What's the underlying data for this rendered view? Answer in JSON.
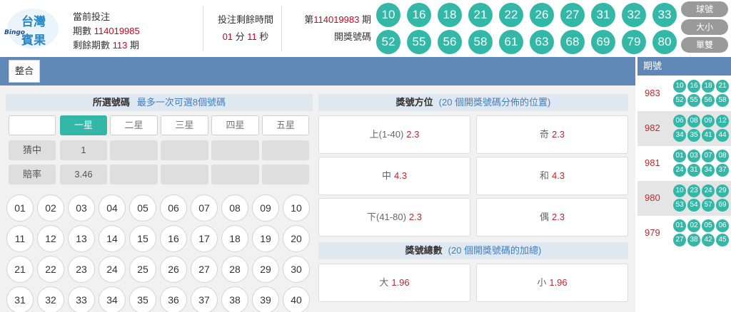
{
  "brand": {
    "logo_line1": "台灣",
    "logo_line2": "賓果",
    "logo_tag": "Bingo"
  },
  "current": {
    "label": "當前投注",
    "period_label": "期數",
    "period_value": "114019985",
    "remaining_label": "剩餘期數",
    "remaining_value": "113",
    "remaining_unit": "期"
  },
  "countdown": {
    "label": "投注剩餘時間",
    "minutes": "01",
    "minutes_unit": "分",
    "seconds": "11",
    "seconds_unit": "秒"
  },
  "draw": {
    "prefix": "第",
    "period": "114019983",
    "suffix": "期",
    "label": "開獎號碼",
    "numbers": [
      "10",
      "16",
      "18",
      "21",
      "22",
      "26",
      "27",
      "31",
      "32",
      "33",
      "52",
      "55",
      "56",
      "58",
      "61",
      "63",
      "68",
      "69",
      "79",
      "80"
    ]
  },
  "view_buttons": [
    "球號",
    "大小",
    "單雙"
  ],
  "toolbar": {
    "tab_label": "整合"
  },
  "selection": {
    "title": "所選號碼",
    "hint": "最多一次可選8個號碼",
    "star_tabs": [
      {
        "label": "",
        "active": false
      },
      {
        "label": "一星",
        "active": true
      },
      {
        "label": "二星",
        "active": false
      },
      {
        "label": "三星",
        "active": false
      },
      {
        "label": "四星",
        "active": false
      },
      {
        "label": "五星",
        "active": false
      }
    ],
    "hit_row": {
      "label": "猜中",
      "values": [
        "1",
        "",
        "",
        "",
        ""
      ]
    },
    "odds_row": {
      "label": "賠率",
      "values": [
        "3.46",
        "",
        "",
        "",
        ""
      ]
    },
    "numbers": [
      "01",
      "02",
      "03",
      "04",
      "05",
      "06",
      "07",
      "08",
      "09",
      "10",
      "11",
      "12",
      "13",
      "14",
      "15",
      "16",
      "17",
      "18",
      "19",
      "20",
      "21",
      "22",
      "23",
      "24",
      "25",
      "26",
      "27",
      "28",
      "29",
      "30",
      "31",
      "32",
      "33",
      "34",
      "35",
      "36",
      "37",
      "38",
      "39",
      "40"
    ]
  },
  "position": {
    "title": "獎號方位",
    "hint": "(20 個開獎號碼分佈的位置)",
    "cells": [
      {
        "label": "上(1-40)",
        "odds": "2.3"
      },
      {
        "label": "奇",
        "odds": "2.3"
      },
      {
        "label": "中",
        "odds": "4.3"
      },
      {
        "label": "和",
        "odds": "4.3"
      },
      {
        "label": "下(41-80)",
        "odds": "2.3"
      },
      {
        "label": "偶",
        "odds": "2.3"
      }
    ]
  },
  "sum": {
    "title": "獎號總數",
    "hint": "(20 個開獎號碼的加總)",
    "cells": [
      {
        "label": "大",
        "odds": "1.96"
      },
      {
        "label": "小",
        "odds": "1.96"
      }
    ]
  },
  "history": {
    "header": "期號",
    "rows": [
      {
        "period": "983",
        "balls": [
          "10",
          "16",
          "18",
          "21",
          "52",
          "55",
          "56",
          "58"
        ]
      },
      {
        "period": "982",
        "balls": [
          "06",
          "08",
          "09",
          "12",
          "34",
          "35",
          "41",
          "44"
        ]
      },
      {
        "period": "981",
        "balls": [
          "01",
          "03",
          "07",
          "08",
          "24",
          "31",
          "34",
          "37"
        ]
      },
      {
        "period": "980",
        "balls": [
          "10",
          "23",
          "24",
          "29",
          "53",
          "54",
          "57",
          "69"
        ]
      },
      {
        "period": "979",
        "balls": [
          "01",
          "02",
          "05",
          "06",
          "27",
          "38",
          "42",
          "45"
        ]
      }
    ]
  },
  "colors": {
    "teal": "#33b7a7",
    "band_blue": "#5f88b6",
    "odds_red": "#c0282d"
  }
}
